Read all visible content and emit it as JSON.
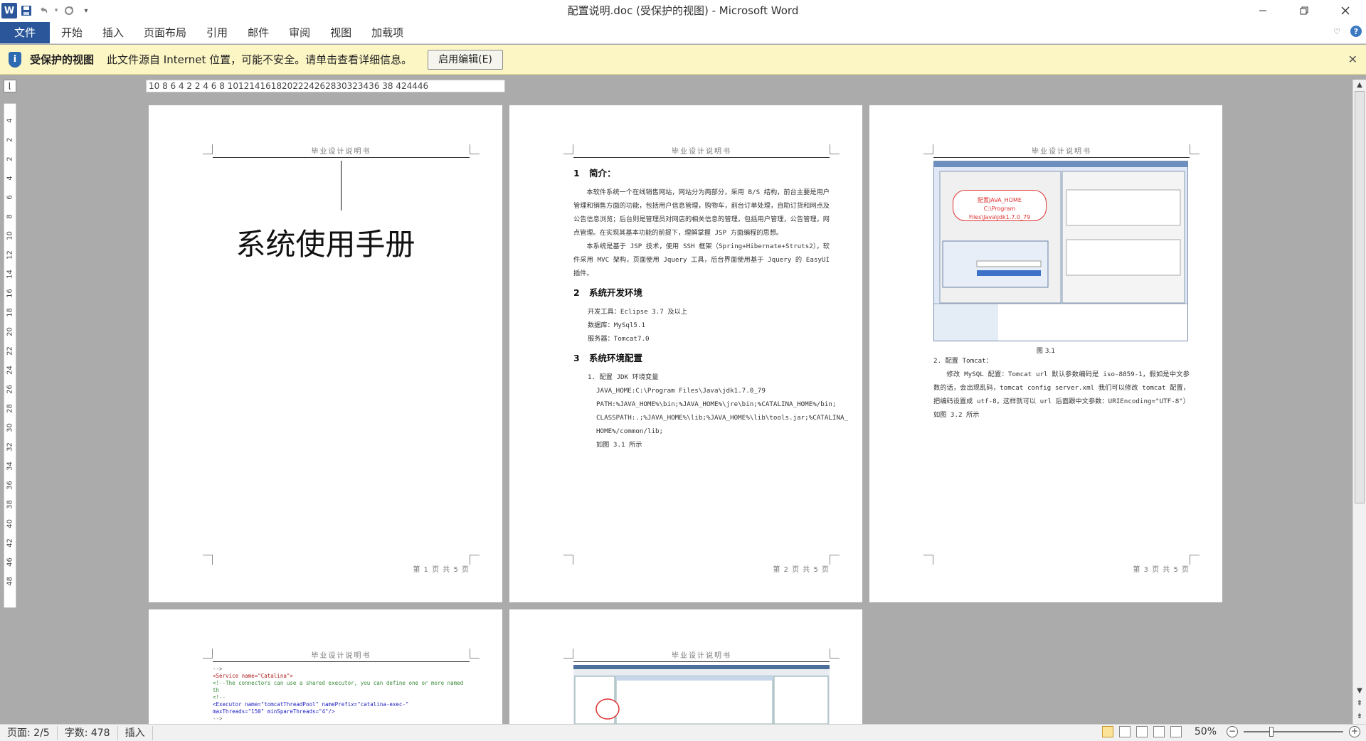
{
  "titlebar": {
    "app_icon_letter": "W",
    "title": "配置说明.doc (受保护的视图) - Microsoft Word",
    "qat_dropdown": "▾"
  },
  "ribbon": {
    "tabs": [
      "文件",
      "开始",
      "插入",
      "页面布局",
      "引用",
      "邮件",
      "审阅",
      "视图",
      "加载项"
    ]
  },
  "protected_view": {
    "title": "受保护的视图",
    "message": "此文件源自 Internet 位置，可能不安全。请单击查看详细信息。",
    "button_label": "启用编辑(E)"
  },
  "rulers": {
    "horizontal": "10 8  6  4  2   2  4  6  8 1012141618202224262830323436 38  424446",
    "vertical": [
      "4",
      "2",
      "2",
      "4",
      "6",
      "8",
      "10",
      "12",
      "14",
      "16",
      "18",
      "20",
      "22",
      "24",
      "26",
      "28",
      "30",
      "32",
      "34",
      "36",
      "38",
      "40",
      "42",
      "46",
      "48"
    ]
  },
  "document": {
    "header_text": "毕业设计说明书",
    "page1": {
      "title": "系统使用手册",
      "footer": "第 1 页  共 5 页"
    },
    "page2": {
      "footer": "第 2 页  共 5 页",
      "sec1_num": "1",
      "sec1_title": "简介：",
      "sec1_p1": "本软件系统一个在线销售网站，网站分为两部分，采用 B/S 结构，前台主要是用户管理和销售方面的功能，包括用户信息管理，购物车，前台订单处理，自助订货和网点及公告信息浏览；后台则是管理员对网店的相关信息的管理，包括用户管理，公告管理，网点管理。在实现其基本功能的前提下，理解掌握 JSP 方面编程的思想。",
      "sec1_p2": "本系统是基于 JSP 技术，使用 SSH 框架（Spring+Hibernate+Struts2），软件采用 MVC 架构，页面使用 Jquery 工具，后台界面使用基于 Jquery 的 EasyUI 插件。",
      "sec2_num": "2",
      "sec2_title": "系统开发环境",
      "sec2_lines": [
        "开发工具：Eclipse 3.7 及以上",
        "数据库：MySql5.1",
        "服务器：Tomcat7.0"
      ],
      "sec3_num": "3",
      "sec3_title": "系统环境配置",
      "sec3_item": "1.  配置 JDK 环境变量",
      "sec3_lines": [
        "JAVA_HOME:C:\\Program Files\\Java\\jdk1.7.0_79",
        "PATH:%JAVA_HOME%\\bin;%JAVA_HOME%\\jre\\bin;%CATALINA_HOME%/bin;",
        "CLASSPATH:.;%JAVA_HOME%\\lib;%JAVA_HOME%\\lib\\tools.jar;%CATALINA_",
        "HOME%/common/lib;",
        "如图 3.1 所示"
      ]
    },
    "page3": {
      "footer": "第 3 页  共 5 页",
      "bubble_line1": "配置JAVA_HOME",
      "bubble_line2": "C:\\Program Files\\Java\\jdk1.7.0_79",
      "caption": "图 3.1",
      "item": "2.  配置 Tomcat：",
      "para": "修改 MySQL 配置：Tomcat url 默认参数编码是 iso-8859-1，假如是中文参数的话，会出现乱码，tomcat config server.xml 我们可以修改 tomcat 配置，把编码设置成 utf-8，这样就可以 url 后面跟中文参数：URIEncoding=\"UTF-8\"）如图 3.2 所示"
    },
    "page4": {
      "code_lines": [
        "-->",
        "<Service name=\"Catalina\">",
        "",
        "<!--The connectors can use a shared executor, you can define one or more named th",
        "<!--",
        "<Executor name=\"tomcatThreadPool\" namePrefix=\"catalina-exec-\"",
        "    maxThreads=\"150\" minSpareThreads=\"4\"/>",
        "-->"
      ]
    }
  },
  "statusbar": {
    "page": "页面: 2/5",
    "words": "字数: 478",
    "mode": "插入",
    "zoom": "50%",
    "zoom_fraction": 0.27
  }
}
